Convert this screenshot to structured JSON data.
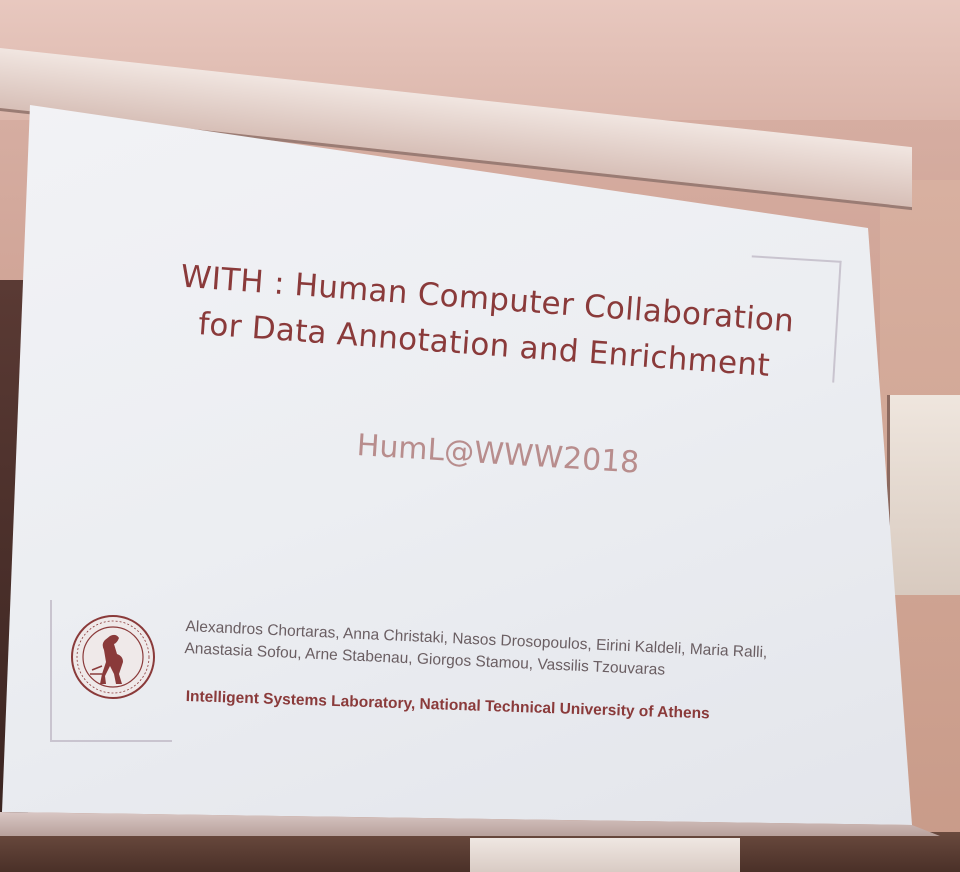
{
  "slide": {
    "title": "WITH : Human Computer Collaboration for Data Annotation and Enrichment",
    "subtitle": "HumL@WWW2018",
    "authors": "Alexandros Chortaras, Anna Christaki, Nasos Drosopoulos, Eirini Kaldeli, Maria Ralli,  Anastasia Sofou, Arne Stabenau, Giorgos Stamou, Vassilis Tzouvaras",
    "affiliation": "Intelligent Systems Laboratory, National Technical University of Athens",
    "seal": "ntua-seal-icon",
    "colors": {
      "title": "#8a3a3a",
      "subtitle": "#b88d8d",
      "authors": "#6a5e62",
      "screen": "#eceef2"
    }
  }
}
